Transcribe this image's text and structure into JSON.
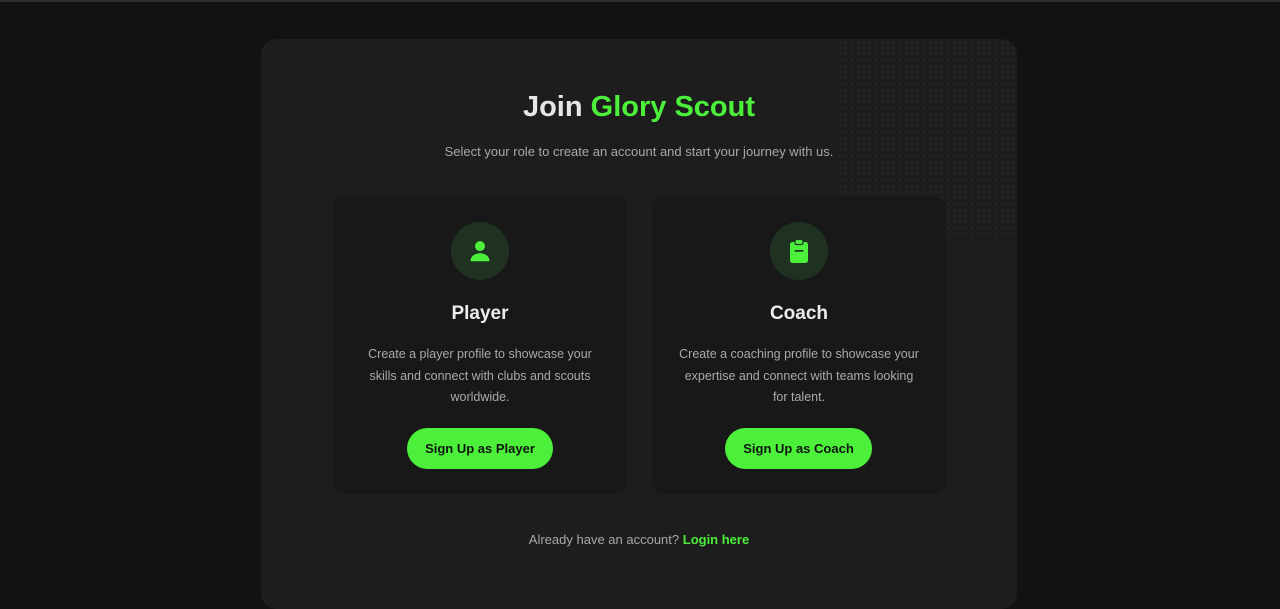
{
  "header": {
    "title_prefix": "Join",
    "title_brand": "Glory Scout",
    "subtitle": "Select your role to create an account and start your journey with us."
  },
  "roles": [
    {
      "icon": "user-icon",
      "title": "Player",
      "description": "Create a player profile to showcase your skills and connect with clubs and scouts worldwide.",
      "button_label": "Sign Up as Player"
    },
    {
      "icon": "clipboard-icon",
      "title": "Coach",
      "description": "Create a coaching profile to showcase your expertise and connect with teams looking for talent.",
      "button_label": "Sign Up as Coach"
    }
  ],
  "footer": {
    "prompt": "Already have an account?",
    "login_link": "Login here"
  },
  "colors": {
    "accent": "#4cf03a",
    "background": "#121212",
    "panel": "#1d1d1d",
    "card": "#181818"
  }
}
